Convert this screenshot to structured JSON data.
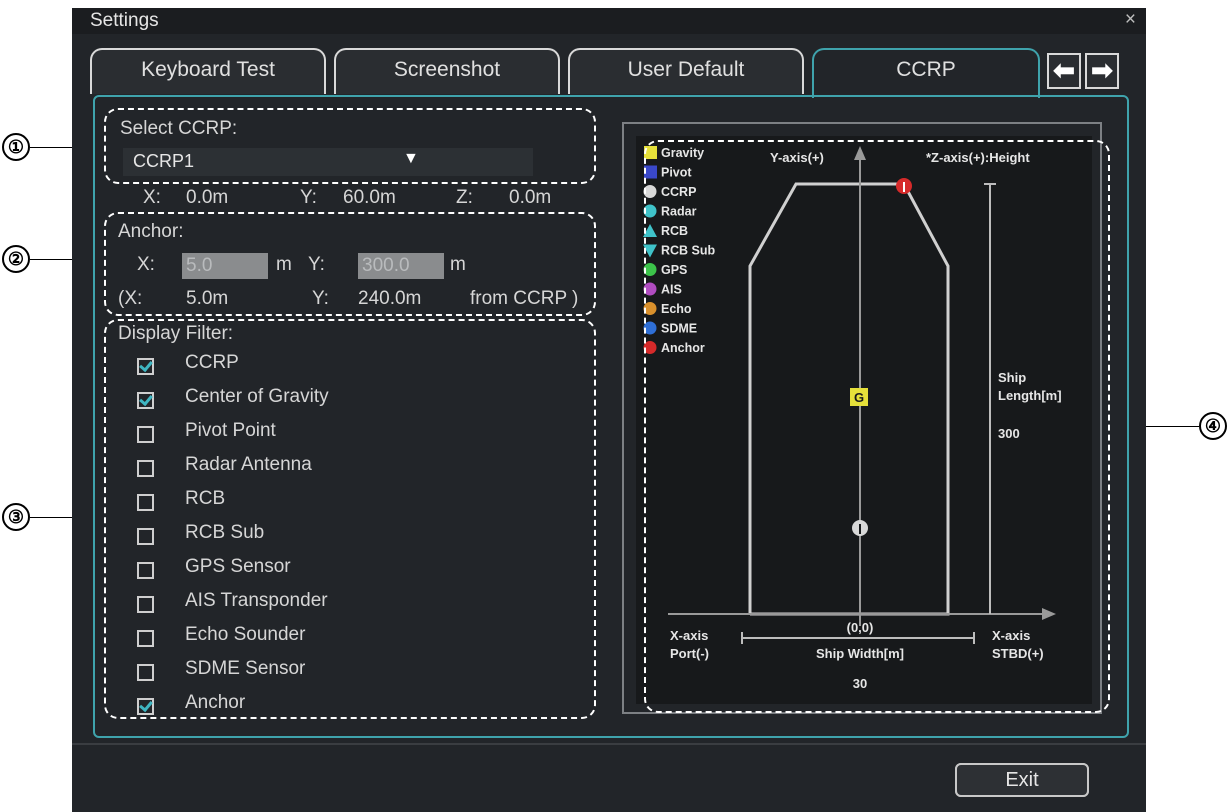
{
  "window": {
    "title": "Settings",
    "close_glyph": "×"
  },
  "tabs": [
    {
      "label": "Keyboard Test"
    },
    {
      "label": "Screenshot"
    },
    {
      "label": "User Default"
    },
    {
      "label": "CCRP"
    }
  ],
  "tab_nav": {
    "prev_glyph": "⬅",
    "next_glyph": "➡"
  },
  "select_ccrp": {
    "label": "Select CCRP:",
    "value": "CCRP1",
    "x_label": "X:",
    "x_value": "0.0m",
    "y_label": "Y:",
    "y_value": "60.0m",
    "z_label": "Z:",
    "z_value": "0.0m"
  },
  "anchor": {
    "label": "Anchor:",
    "x_label": "X:",
    "x_value": "5.0",
    "x_unit": "m",
    "y_label": "Y:",
    "y_value": "300.0",
    "y_unit": "m",
    "rel_prefix": "(X:",
    "rel_x": "5.0m",
    "rel_y_label": "Y:",
    "rel_y": "240.0m",
    "rel_suffix": "from CCRP )"
  },
  "display_filter": {
    "label": "Display Filter:",
    "items": [
      {
        "label": "CCRP",
        "checked": true
      },
      {
        "label": "Center of Gravity",
        "checked": true
      },
      {
        "label": "Pivot Point",
        "checked": false
      },
      {
        "label": "Radar Antenna",
        "checked": false
      },
      {
        "label": "RCB",
        "checked": false
      },
      {
        "label": "RCB Sub",
        "checked": false
      },
      {
        "label": "GPS Sensor",
        "checked": false
      },
      {
        "label": "AIS Transponder",
        "checked": false
      },
      {
        "label": "Echo Sounder",
        "checked": false
      },
      {
        "label": "SDME Sensor",
        "checked": false
      },
      {
        "label": "Anchor",
        "checked": true
      }
    ]
  },
  "diagram": {
    "legend": [
      {
        "label": "Gravity",
        "icon": "gravity-square-icon",
        "color": "#e5e03a"
      },
      {
        "label": "Pivot",
        "icon": "pivot-square-icon",
        "color": "#3a48c9"
      },
      {
        "label": "CCRP",
        "icon": "ccrp-circle-icon",
        "color": "#d8d8d8"
      },
      {
        "label": "Radar",
        "icon": "radar-circle-icon",
        "color": "#3fc3c9"
      },
      {
        "label": "RCB",
        "icon": "rcb-triangle-up-icon",
        "color": "#3fc3c9"
      },
      {
        "label": "RCB Sub",
        "icon": "rcb-sub-triangle-down-icon",
        "color": "#3fc3c9"
      },
      {
        "label": "GPS",
        "icon": "gps-circle-icon",
        "color": "#3cc34a"
      },
      {
        "label": "AIS",
        "icon": "ais-circle-icon",
        "color": "#b04cc0"
      },
      {
        "label": "Echo",
        "icon": "echo-circle-icon",
        "color": "#d9902c"
      },
      {
        "label": "SDME",
        "icon": "sdme-circle-icon",
        "color": "#2f6fd6"
      },
      {
        "label": "Anchor",
        "icon": "anchor-circle-icon",
        "color": "#d62a2a"
      }
    ],
    "y_axis_label": "Y-axis(+)",
    "z_axis_label": "*Z-axis(+):Height",
    "ship_length_label_1": "Ship",
    "ship_length_label_2": "Length[m]",
    "ship_length_value": "300",
    "origin_label": "(0,0)",
    "x_axis_port_1": "X-axis",
    "x_axis_port_2": "Port(-)",
    "x_axis_stbd_1": "X-axis",
    "x_axis_stbd_2": "STBD(+)",
    "ship_width_label": "Ship Width[m]",
    "ship_width_value": "30",
    "gravity_glyph": "G"
  },
  "callouts": [
    "①",
    "②",
    "③",
    "④"
  ],
  "exit_label": "Exit"
}
